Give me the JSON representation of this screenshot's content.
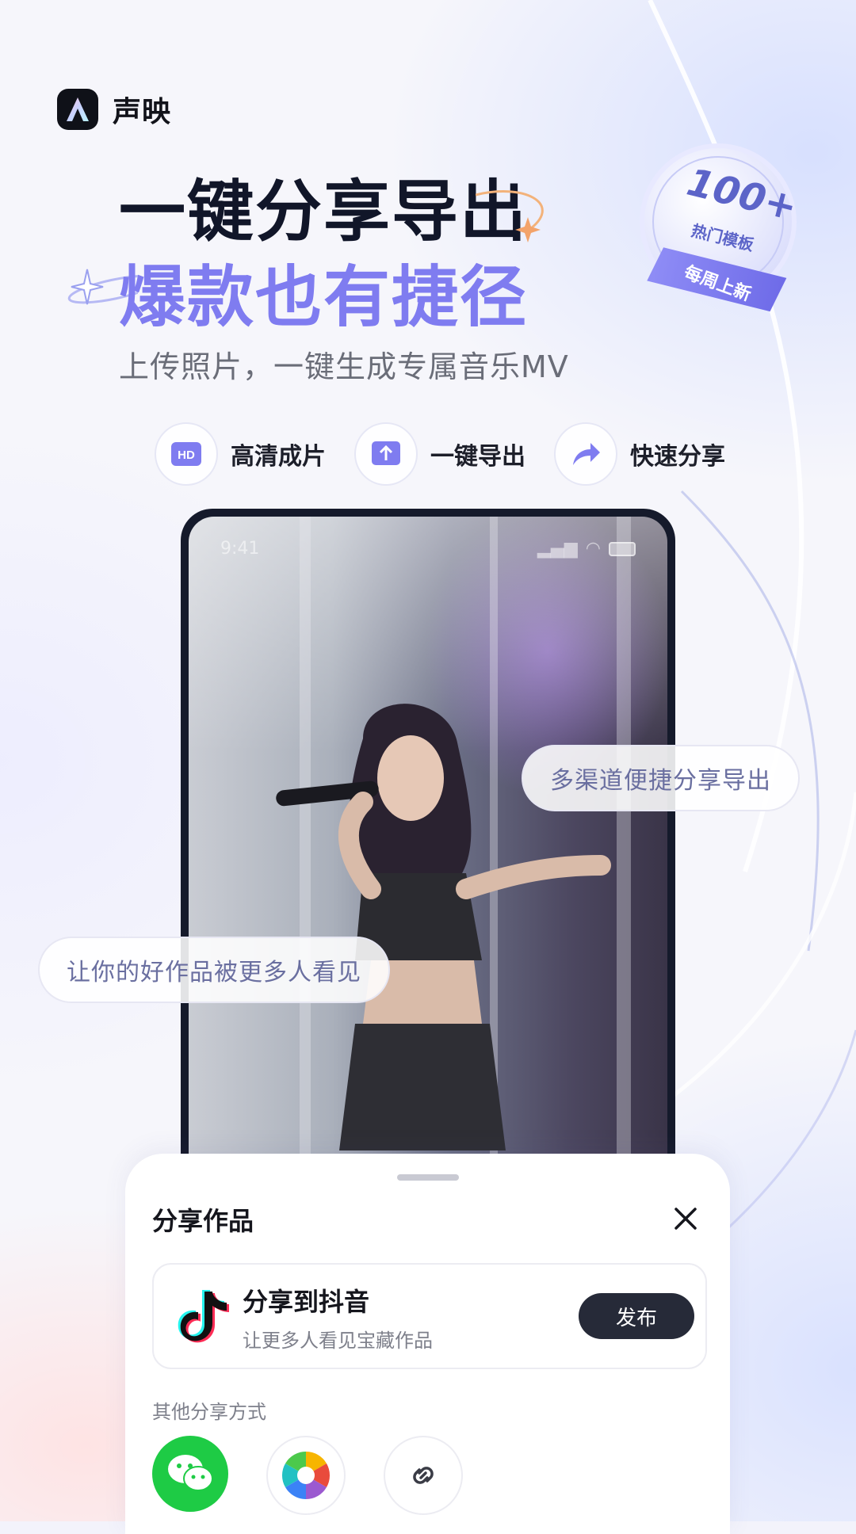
{
  "brand": {
    "name": "声映"
  },
  "hero": {
    "title_line1": "一键分享导出",
    "title_line2": "爆款也有捷径",
    "subtitle": "上传照片，一键生成专属音乐MV"
  },
  "badge": {
    "count": "100+",
    "label": "热门模板",
    "ribbon": "每周上新"
  },
  "features": [
    {
      "icon": "hd-icon",
      "label": "高清成片"
    },
    {
      "icon": "export-icon",
      "label": "一键导出"
    },
    {
      "icon": "share-arrow-icon",
      "label": "快速分享"
    }
  ],
  "phone": {
    "time": "9:41"
  },
  "bubbles": {
    "right": "多渠道便捷分享导出",
    "left": "让你的好作品被更多人看见"
  },
  "share_sheet": {
    "title": "分享作品",
    "douyin": {
      "title": "分享到抖音",
      "subtitle": "让更多人看见宝藏作品",
      "button": "发布"
    },
    "other_label": "其他分享方式",
    "options": [
      "wechat-icon",
      "moments-icon",
      "link-icon"
    ]
  },
  "colors": {
    "accent": "#7f7cf0",
    "dark": "#111629",
    "wechat": "#1ecb45"
  }
}
